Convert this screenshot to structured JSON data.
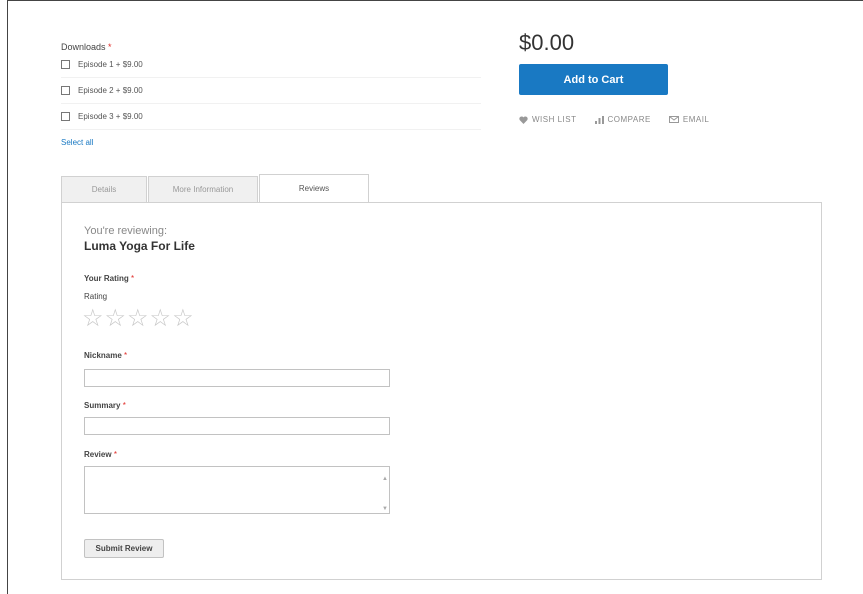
{
  "downloads": {
    "title": "Downloads",
    "required_mark": "*",
    "items": [
      {
        "label": "Episode 1 + $9.00"
      },
      {
        "label": "Episode 2 + $9.00"
      },
      {
        "label": "Episode 3 + $9.00"
      }
    ],
    "select_all": "Select all"
  },
  "product": {
    "price": "$0.00",
    "add_to_cart": "Add to Cart",
    "actions": {
      "wishlist": "WISH LIST",
      "compare": "COMPARE",
      "email": "EMAIL"
    }
  },
  "tabs": [
    {
      "label": "Details"
    },
    {
      "label": "More Information"
    },
    {
      "label": "Reviews",
      "active": true
    }
  ],
  "review": {
    "reviewing_label": "You're reviewing:",
    "product_name": "Luma Yoga For Life",
    "your_rating": "Your Rating",
    "rating": "Rating",
    "stars": 5,
    "nickname": "Nickname",
    "summary": "Summary",
    "review": "Review",
    "submit": "Submit Review",
    "required_mark": "*"
  },
  "colors": {
    "accent": "#1979c3",
    "required": "#e02b27"
  }
}
